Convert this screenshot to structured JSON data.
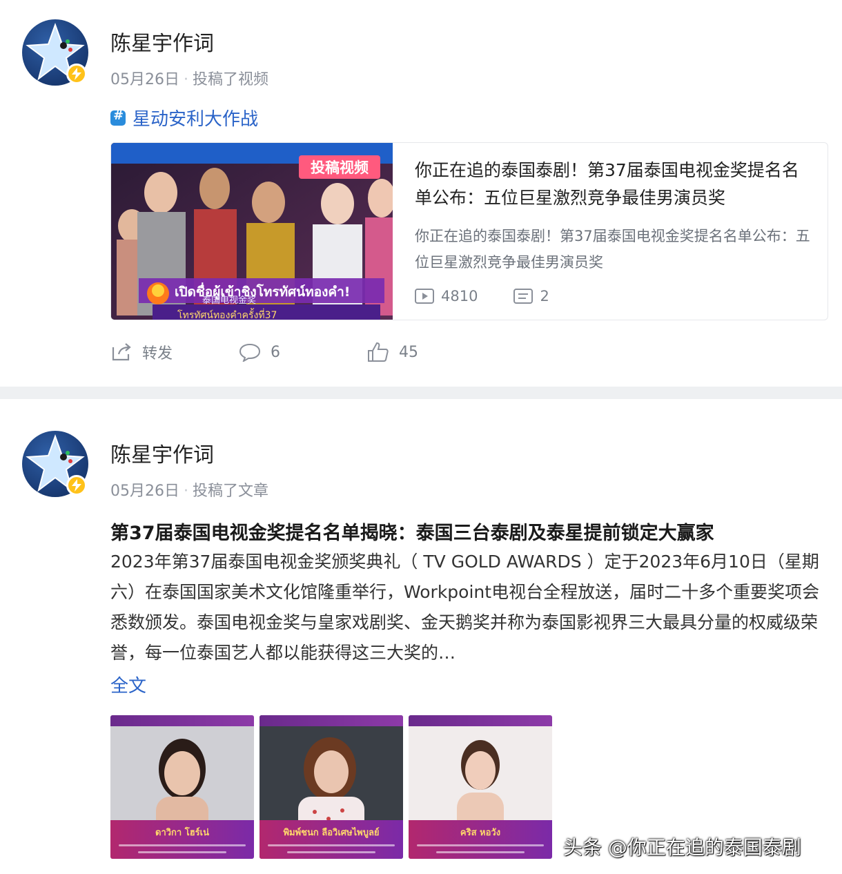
{
  "post1": {
    "username": "陈星宇作词",
    "date": "05月26日",
    "separator": "·",
    "action": "投稿了视频",
    "topic": "星动安利大作战",
    "card": {
      "thumb_badge": "投稿视频",
      "thumb_caption": "เปิดชื่อผู้เข้าชิงโทรทัศน์ทองคำ!",
      "thumb_sub": "泰国电视金奖",
      "thumb_sub2": "โทรทัศน์ทองคำครั้งที่37",
      "title": "你正在追的泰国泰剧！第37届泰国电视金奖提名名单公布：五位巨星激烈竞争最佳男演员奖",
      "desc": "你正在追的泰国泰剧！第37届泰国电视金奖提名名单公布：五位巨星激烈竞争最佳男演员奖",
      "plays": "4810",
      "comments": "2"
    },
    "actions": {
      "repost": "转发",
      "comments": "6",
      "likes": "45"
    }
  },
  "post2": {
    "username": "陈星宇作词",
    "date": "05月26日",
    "separator": "·",
    "action": "投稿了文章",
    "article_title": "第37届泰国电视金奖提名名单揭晓：泰国三台泰剧及泰星提前锁定大赢家",
    "article_body": "2023年第37届泰国电视金奖颁奖典礼（ TV GOLD AWARDS ）定于2023年6月10日（星期六）在泰国国家美术文化馆隆重举行，Workpoint电视台全程放送，届时二十多个重要奖项会悉数颁发。泰国电视金奖与皇家戏剧奖、金天鹅奖并称为泰国影视界三大最具分量的权威级荣誉，每一位泰国艺人都以能获得这三大奖的…",
    "full_text_link": "全文",
    "photos": [
      {
        "name": "ดาวิกา โฮร์เน่"
      },
      {
        "name": "พิมพ์ชนก ลือวิเศษไพบูลย์"
      },
      {
        "name": "คริส หอวัง"
      }
    ]
  },
  "watermark": "头条 @你正在追的泰国泰剧",
  "colors": {
    "link": "#2a63c8",
    "badge": "#ffc21a",
    "accent_purple": "#7b2aa8"
  }
}
